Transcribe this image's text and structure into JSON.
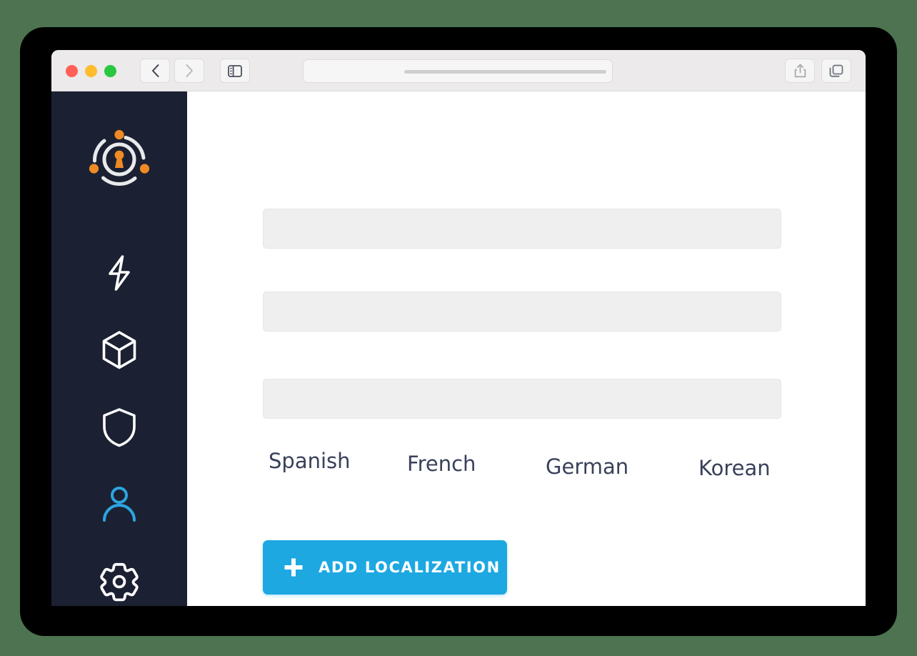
{
  "window": {
    "traffic_lights": [
      {
        "name": "close",
        "color": "#ff5f57"
      },
      {
        "name": "minimize",
        "color": "#febc2e"
      },
      {
        "name": "maximize",
        "color": "#28c840"
      }
    ],
    "toolbar": {
      "back_icon": "chevron-left-icon",
      "forward_icon": "chevron-right-icon",
      "sidebar_toggle_icon": "sidebar-toggle-icon",
      "share_icon": "share-icon",
      "tabs_overview_icon": "tabs-overview-icon",
      "address_value": "",
      "address_placeholder": ""
    }
  },
  "sidebar": {
    "background": "#1b2132",
    "logo": {
      "name": "app-logo-lock",
      "ring_color": "#ffffff",
      "accent_color": "#f08a24"
    },
    "items": [
      {
        "icon": "lightning-bolt-icon",
        "color": "#ffffff",
        "active": false
      },
      {
        "icon": "cube-icon",
        "color": "#ffffff",
        "active": false
      },
      {
        "icon": "shield-icon",
        "color": "#ffffff",
        "active": false
      },
      {
        "icon": "user-icon",
        "color": "#2ba6e0",
        "active": true
      },
      {
        "icon": "gear-icon",
        "color": "#ffffff",
        "active": false
      }
    ]
  },
  "main": {
    "fields": [
      {
        "value": "",
        "placeholder": ""
      },
      {
        "value": "",
        "placeholder": ""
      },
      {
        "value": "",
        "placeholder": ""
      }
    ],
    "languages": [
      "Spanish",
      "French",
      "German",
      "Korean"
    ],
    "add_button": {
      "label": "ADD LOCALIZATION",
      "icon": "plus-icon",
      "color": "#1da8e2"
    }
  }
}
